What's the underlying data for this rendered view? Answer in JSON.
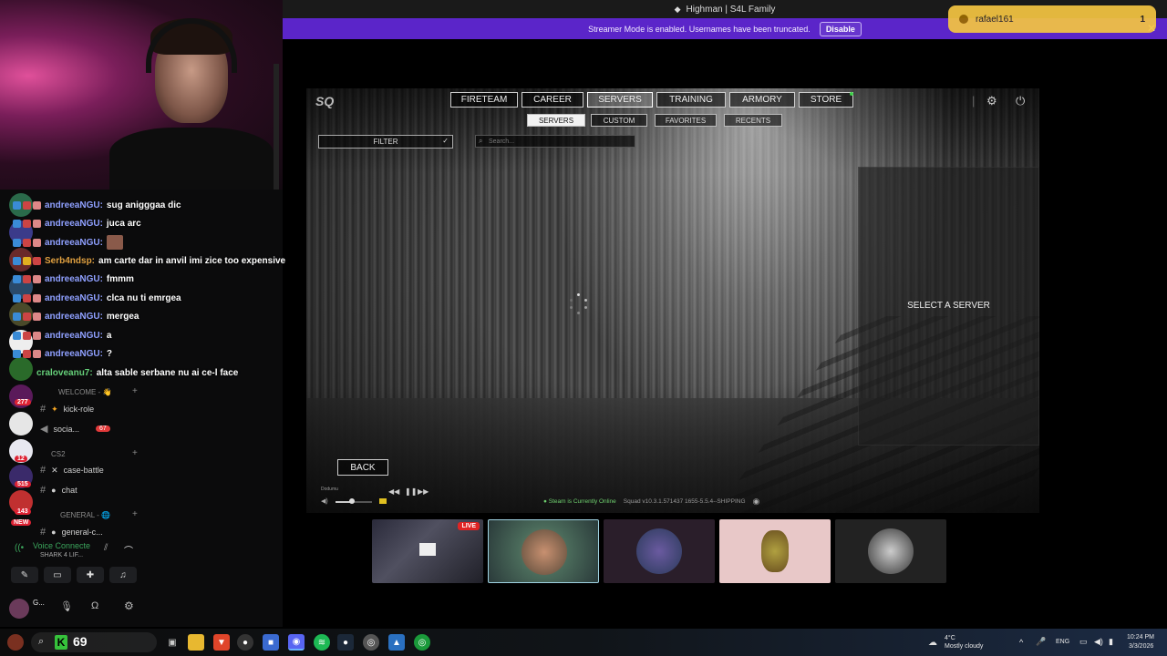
{
  "window_title": "Highman | S4L Family",
  "streamer_bar": {
    "message": "Streamer Mode is enabled. Usernames have been truncated.",
    "disable_label": "Disable",
    "close_glyph": "✕"
  },
  "notification": {
    "user": "rafael161",
    "count": "1"
  },
  "chat": [
    {
      "user": "andreeaNGU:",
      "message": "sug anigggaa dic",
      "user_color": "#8fa0ff"
    },
    {
      "user": "andreeaNGU:",
      "message": "juca arc",
      "user_color": "#8fa0ff"
    },
    {
      "user": "andreeaNGU:",
      "message": "",
      "user_color": "#8fa0ff"
    },
    {
      "user": "Serb4ndsp:",
      "message": "am carte dar in anvil imi zice too expensive",
      "user_color": "#e0a040"
    },
    {
      "user": "andreeaNGU:",
      "message": "fmmm",
      "user_color": "#8fa0ff"
    },
    {
      "user": "andreeaNGU:",
      "message": "clca nu ti emrgea",
      "user_color": "#8fa0ff"
    },
    {
      "user": "andreeaNGU:",
      "message": "mergea",
      "user_color": "#8fa0ff"
    },
    {
      "user": "andreeaNGU:",
      "message": "a",
      "user_color": "#8fa0ff"
    },
    {
      "user": "andreeaNGU:",
      "message": "?",
      "user_color": "#8fa0ff"
    },
    {
      "user": "cralovea​nu7:",
      "message": "alta sable serbane nu ai ce-l face",
      "user_color": "#66d07a"
    }
  ],
  "discord": {
    "categories": [
      {
        "label": "WELCOME - 👋"
      },
      {
        "label": "CS2"
      },
      {
        "label": "GENERAL - 🌐"
      }
    ],
    "channels": [
      {
        "label": "kick-role",
        "badge": ""
      },
      {
        "label": "socia...",
        "badge": "67"
      },
      {
        "label": "case-battle",
        "badge": ""
      },
      {
        "label": "chat",
        "badge": ""
      },
      {
        "label": "general-c...",
        "badge": ""
      }
    ],
    "rail_badges": [
      "277",
      "12",
      "515",
      "143",
      "NEW"
    ],
    "voice_title": "Voice Connecte",
    "voice_sub": "SHARK 4 LIF...",
    "user_name": "G..."
  },
  "game": {
    "logo": "SQ",
    "nav_tabs": [
      {
        "label": "FIRETEAM",
        "active": false
      },
      {
        "label": "CAREER",
        "active": false
      },
      {
        "label": "SERVERS",
        "active": true
      },
      {
        "label": "TRAINING",
        "active": false
      },
      {
        "label": "ARMORY",
        "active": false
      },
      {
        "label": "STORE",
        "active": false
      }
    ],
    "sub_tabs": [
      {
        "label": "SERVERS",
        "active": true
      },
      {
        "label": "CUSTOM",
        "active": false
      },
      {
        "label": "FAVORITES",
        "active": false
      },
      {
        "label": "RECENTS",
        "active": false
      }
    ],
    "filter_label": "FILTER",
    "search_placeholder": "Search...",
    "select_server_label": "SELECT A SERVER",
    "back_label": "BACK",
    "music_track": "Dodumu",
    "volume": 0.45,
    "status_online": "Steam is Currently Online",
    "version": "Squad v10.3.1.571437 1655-5.5.4--SHIPPING"
  },
  "thumbnails": [
    {
      "name": "screen-share",
      "live": "LIVE",
      "selected": false
    },
    {
      "name": "squad-game",
      "live": "",
      "selected": true
    },
    {
      "name": "avatar-warrior",
      "live": "",
      "selected": false
    },
    {
      "name": "avatar-turtle",
      "live": "",
      "selected": false
    },
    {
      "name": "avatar-bw",
      "live": "",
      "selected": false
    }
  ],
  "taskbar": {
    "counter": "69",
    "weather_temp": "4°C",
    "weather_desc": "Mostly cloudy",
    "lang": "ENG",
    "time": "10:24 PM",
    "date": "3/3/2026"
  }
}
